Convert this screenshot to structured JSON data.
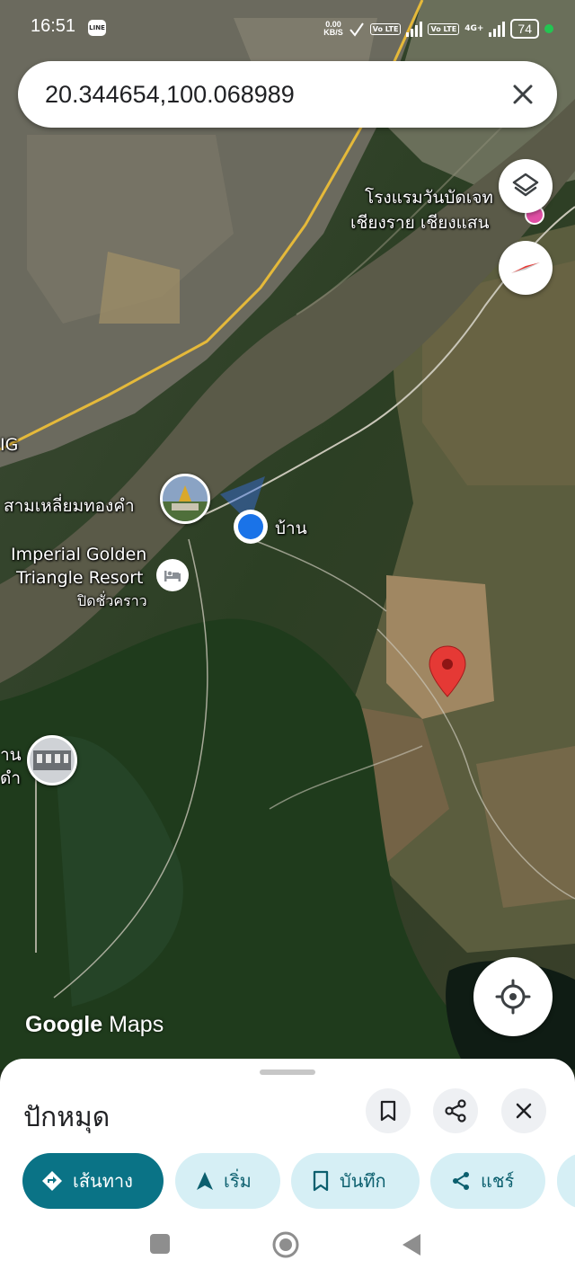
{
  "status_bar": {
    "time": "16:51",
    "line_badge": "LINE",
    "net_speed_value": "0.00",
    "net_speed_unit": "KB/S",
    "volte_1": "Vo LTE",
    "volte_2": "Vo LTE",
    "network_type": "4G+",
    "battery": "74"
  },
  "search": {
    "query": "20.344654,100.068989",
    "close_icon": "close-icon"
  },
  "map": {
    "labels": {
      "hotel_line1": "โรงแรมวันบัดเจท",
      "hotel_line2": "เชียงราย เชียงแสน",
      "golden_triangle": "สามเหลี่ยมทองคำ",
      "home": "บ้าน",
      "resort_line1": "Imperial Golden",
      "resort_line2": "Triangle Resort",
      "resort_status": "ปิดชั่วคราว",
      "edge_ig": "IG",
      "edge_left1": "าน",
      "edge_left2": "ดำ"
    },
    "attribution_google": "Google",
    "attribution_maps": "Maps",
    "icons": [
      "layers-icon",
      "compass-icon",
      "my-location-icon",
      "red-pin-icon",
      "blue-dot-icon",
      "hotel-icon"
    ]
  },
  "sheet": {
    "title": "ปักหมุด",
    "actions": [
      "bookmark-icon",
      "share-icon",
      "close-icon"
    ],
    "chips": [
      {
        "label": "เส้นทาง",
        "icon": "directions-icon"
      },
      {
        "label": "เริ่ม",
        "icon": "navigation-arrow-icon"
      },
      {
        "label": "บันทึก",
        "icon": "bookmark-icon"
      },
      {
        "label": "แชร์",
        "icon": "share-icon"
      }
    ]
  },
  "colors": {
    "accent": "#0a7386",
    "chip_bg": "#d6eff5",
    "pin_red": "#e53935",
    "location_blue": "#1a73e8"
  }
}
